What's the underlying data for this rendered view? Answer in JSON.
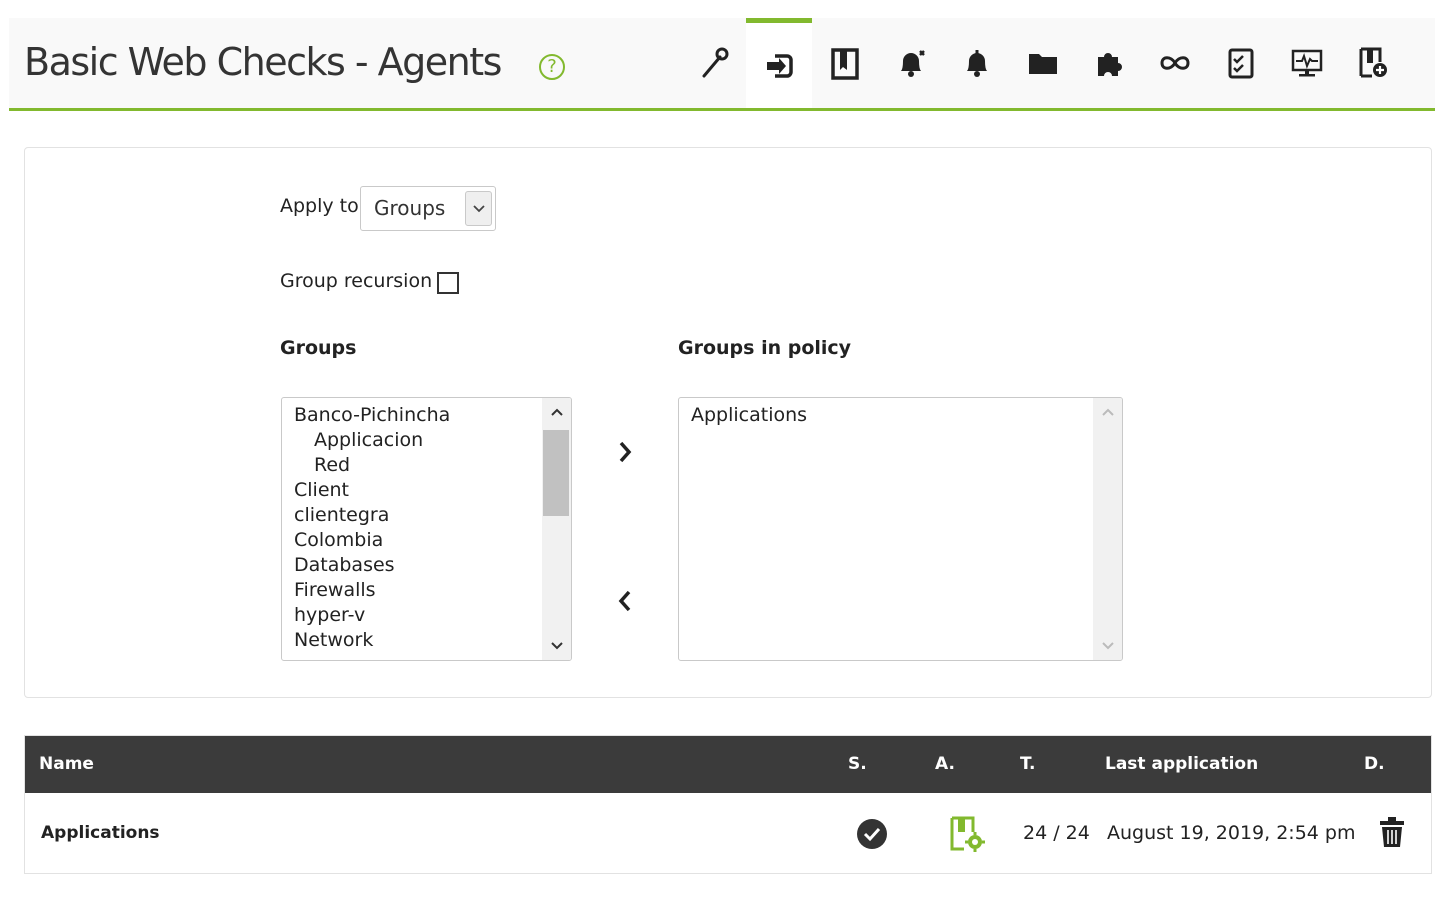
{
  "header": {
    "title": "Basic Web Checks - Agents",
    "help_icon": "help-circle-icon",
    "accent_color": "#82b92e",
    "tabs": [
      {
        "icon": "wrench-icon",
        "name": "tab-setup",
        "active": false
      },
      {
        "icon": "agent-login-icon",
        "name": "tab-agents",
        "active": true
      },
      {
        "icon": "module-book-icon",
        "name": "tab-modules",
        "active": false
      },
      {
        "icon": "alert-bell-plus-icon",
        "name": "tab-alerts",
        "active": false
      },
      {
        "icon": "bell-icon",
        "name": "tab-external-alerts",
        "active": false
      },
      {
        "icon": "folder-icon",
        "name": "tab-collections",
        "active": false
      },
      {
        "icon": "puzzle-plugin-icon",
        "name": "tab-plugins",
        "active": false
      },
      {
        "icon": "infinity-link-icon",
        "name": "tab-inventory",
        "active": false
      },
      {
        "icon": "checklist-icon",
        "name": "tab-queue",
        "active": false
      },
      {
        "icon": "monitor-pulse-icon",
        "name": "tab-monitoring",
        "active": false
      },
      {
        "icon": "add-module-icon",
        "name": "tab-add-module",
        "active": false
      }
    ]
  },
  "form": {
    "apply_to_label": "Apply to",
    "apply_to_value": "Groups",
    "group_recursion_label": "Group recursion",
    "group_recursion_checked": false,
    "groups_header": "Groups",
    "groups_in_policy_header": "Groups in policy",
    "groups_list": [
      {
        "label": "Banco-Pichincha",
        "indent": 0
      },
      {
        "label": "Applicacion",
        "indent": 1
      },
      {
        "label": "Red",
        "indent": 1
      },
      {
        "label": "Client",
        "indent": 0
      },
      {
        "label": "clientegra",
        "indent": 0
      },
      {
        "label": "Colombia",
        "indent": 0
      },
      {
        "label": "Databases",
        "indent": 0
      },
      {
        "label": "Firewalls",
        "indent": 0
      },
      {
        "label": "hyper-v",
        "indent": 0
      },
      {
        "label": "Network",
        "indent": 0
      }
    ],
    "policy_groups": [
      "Applications"
    ]
  },
  "table": {
    "columns": {
      "name": "Name",
      "status": "S.",
      "apply": "A.",
      "total": "T.",
      "last_application": "Last application",
      "delete": "D."
    },
    "rows": [
      {
        "name": "Applications",
        "status_icon": "check-circle-icon",
        "apply_icon": "apply-policy-icon",
        "total": "24 / 24",
        "last_application": "August 19, 2019, 2:54 pm",
        "delete_icon": "trash-icon"
      }
    ]
  }
}
